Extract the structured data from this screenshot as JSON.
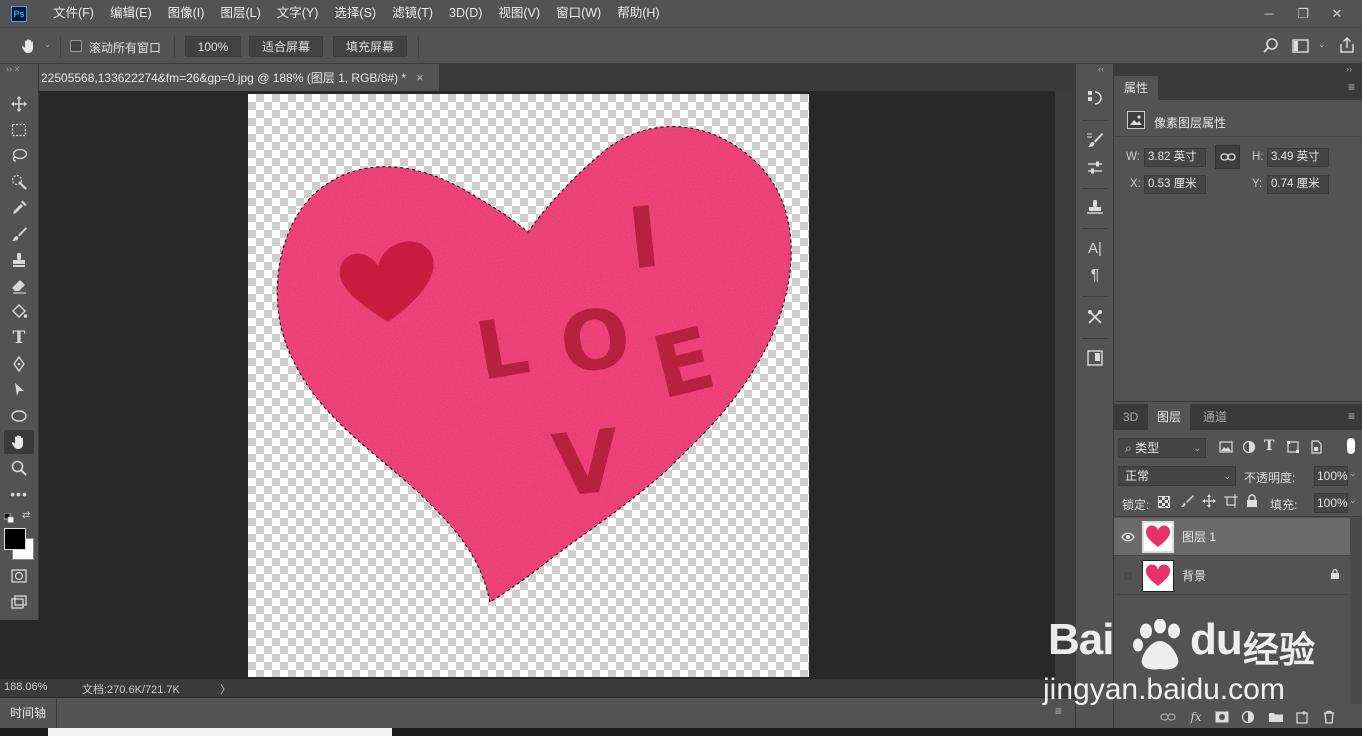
{
  "app": {
    "logo": "Ps",
    "menus": [
      "文件(F)",
      "编辑(E)",
      "图像(I)",
      "图层(L)",
      "文字(Y)",
      "选择(S)",
      "滤镜(T)",
      "3D(D)",
      "视图(V)",
      "窗口(W)",
      "帮助(H)"
    ],
    "window_controls": [
      "─",
      "❐",
      "✕"
    ]
  },
  "options": {
    "scroll_all_windows_label": "滚动所有窗口",
    "zoom_value": "100%",
    "fit_screen_label": "适合屏幕",
    "fill_screen_label": "填充屏幕"
  },
  "document": {
    "tab_title": "22505568,133622274&fm=26&gp=0.jpg @ 188% (图层 1, RGB/8#) *",
    "close_icon": "×",
    "image_letters": [
      "I",
      "L",
      "O",
      "E",
      "V"
    ]
  },
  "status": {
    "zoom": "188.06%",
    "doc_info": "文档:270.6K/721.7K",
    "arrow": "〉"
  },
  "timeline": {
    "label": "时间轴"
  },
  "properties": {
    "tab_label": "属性",
    "section_label": "像素图层属性",
    "w_label": "W:",
    "w_value": "3.82 英寸",
    "h_label": "H:",
    "h_value": "3.49 英寸",
    "x_label": "X:",
    "x_value": "0.53 厘米",
    "y_label": "Y:",
    "y_value": "0.74 厘米"
  },
  "layers_panel": {
    "tabs": [
      "3D",
      "图层",
      "通道"
    ],
    "filter_label": "类型",
    "blend_mode": "正常",
    "opacity_label": "不透明度:",
    "opacity_value": "100%",
    "lock_label": "锁定:",
    "fill_label": "填充:",
    "fill_value": "100%",
    "layers": [
      {
        "name": "图层 1",
        "visible": true,
        "selected": true
      },
      {
        "name": "背景",
        "visible": false,
        "selected": false,
        "locked": true
      }
    ],
    "footer_fx": "fx"
  },
  "watermark": {
    "brand_left": "Bai",
    "brand_right": "du",
    "brand_cn": "经验",
    "url": "jingyan.baidu.com"
  },
  "colors": {
    "heart": "#e8306a",
    "heart_text": "#b0203a",
    "ui_panel": "#535353",
    "ui_dark": "#282828"
  }
}
